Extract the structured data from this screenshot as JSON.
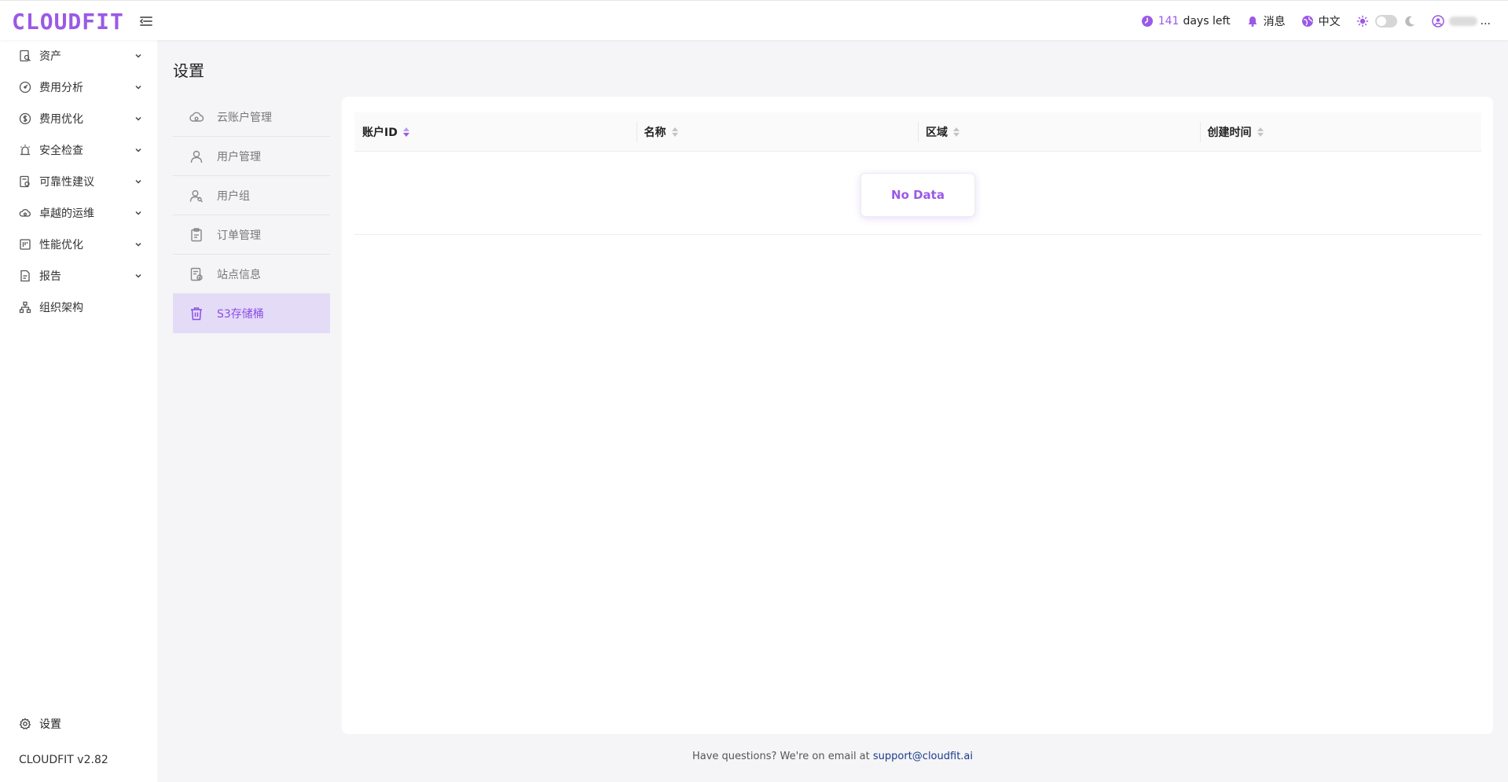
{
  "app": {
    "logo": "CLOUDFIT",
    "accent": "#9b59e6"
  },
  "topbar": {
    "days_number": "141",
    "days_text": "days left",
    "messages_label": "消息",
    "language_label": "中文",
    "user_suffix": "..."
  },
  "sidebar": {
    "items": [
      {
        "label": "资产",
        "icon": "asset-search-icon"
      },
      {
        "label": "费用分析",
        "icon": "gauge-icon"
      },
      {
        "label": "费用优化",
        "icon": "dollar-circle-icon"
      },
      {
        "label": "安全检查",
        "icon": "alarm-icon"
      },
      {
        "label": "可靠性建议",
        "icon": "doc-check-icon"
      },
      {
        "label": "卓越的运维",
        "icon": "cloud-icon"
      },
      {
        "label": "性能优化",
        "icon": "board-icon"
      },
      {
        "label": "报告",
        "icon": "report-icon"
      },
      {
        "label": "组织架构",
        "icon": "org-chart-icon"
      }
    ],
    "settings_label": "设置",
    "version": "CLOUDFIT v2.82"
  },
  "main": {
    "title": "设置",
    "sub_nav": [
      {
        "label": "云账户管理",
        "icon": "cloud-account-icon"
      },
      {
        "label": "用户管理",
        "icon": "user-icon"
      },
      {
        "label": "用户组",
        "icon": "user-group-icon"
      },
      {
        "label": "订单管理",
        "icon": "order-icon"
      },
      {
        "label": "站点信息",
        "icon": "site-info-icon"
      },
      {
        "label": "S3存储桶",
        "icon": "bucket-icon"
      }
    ],
    "active_sub": "S3存储桶",
    "table": {
      "columns": [
        "账户ID",
        "名称",
        "区域",
        "创建时间"
      ],
      "empty_text": "No Data"
    }
  },
  "footer": {
    "text": "Have questions? We're on email at",
    "email": "support@cloudfit.ai"
  }
}
